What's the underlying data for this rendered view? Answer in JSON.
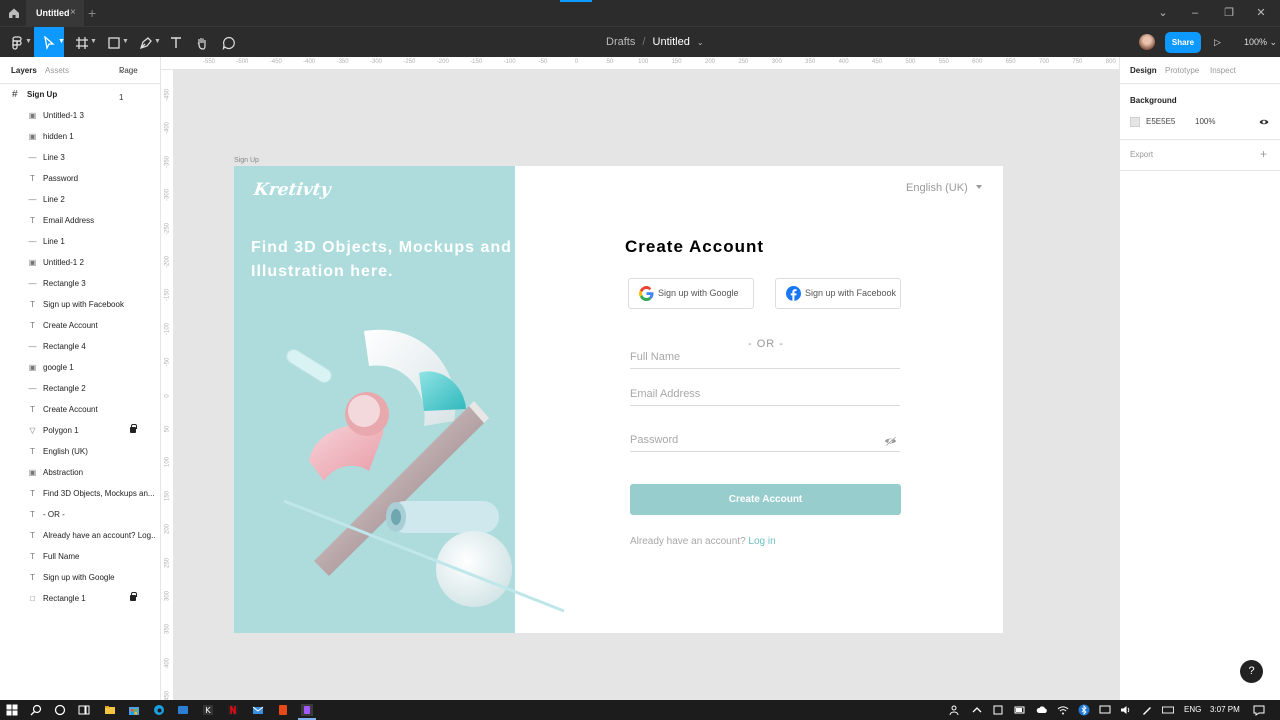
{
  "app": {
    "tab_title": "Untitled",
    "breadcrumb_folder": "Drafts",
    "breadcrumb_separator": "/",
    "breadcrumb_file": "Untitled",
    "share_label": "Share",
    "zoom_label": "100%"
  },
  "left_panel": {
    "tab_layers": "Layers",
    "tab_assets": "Assets",
    "page_selector": "Page 1",
    "frame_name": "Sign Up",
    "layers": [
      {
        "name": "Untitled-1 3",
        "icon": "image-icon",
        "locked": false
      },
      {
        "name": "hidden 1",
        "icon": "image-icon",
        "locked": false
      },
      {
        "name": "Line 3",
        "icon": "line-icon",
        "locked": false
      },
      {
        "name": "Password",
        "icon": "text-icon",
        "locked": false
      },
      {
        "name": "Line 2",
        "icon": "line-icon",
        "locked": false
      },
      {
        "name": "Email Address",
        "icon": "text-icon",
        "locked": false
      },
      {
        "name": "Line 1",
        "icon": "line-icon",
        "locked": false
      },
      {
        "name": "Untitled-1 2",
        "icon": "image-icon",
        "locked": false
      },
      {
        "name": "Rectangle 3",
        "icon": "line-icon",
        "locked": false
      },
      {
        "name": "Sign up with Facebook",
        "icon": "text-icon",
        "locked": false
      },
      {
        "name": "Create Account",
        "icon": "text-icon",
        "locked": false
      },
      {
        "name": "Rectangle 4",
        "icon": "line-icon",
        "locked": false
      },
      {
        "name": "google 1",
        "icon": "image-icon",
        "locked": false
      },
      {
        "name": "Rectangle 2",
        "icon": "line-icon",
        "locked": false
      },
      {
        "name": "Create Account",
        "icon": "text-icon",
        "locked": false
      },
      {
        "name": "Polygon 1",
        "icon": "polygon-icon",
        "locked": true
      },
      {
        "name": "English (UK)",
        "icon": "text-icon",
        "locked": false
      },
      {
        "name": "Abstraction",
        "icon": "image-icon",
        "locked": false
      },
      {
        "name": "Find 3D Objects, Mockups an...",
        "icon": "text-icon",
        "locked": false
      },
      {
        "name": "- OR -",
        "icon": "text-icon",
        "locked": false
      },
      {
        "name": "Already have an account? Log...",
        "icon": "text-icon",
        "locked": false
      },
      {
        "name": "Full Name",
        "icon": "text-icon",
        "locked": false
      },
      {
        "name": "Sign up with Google",
        "icon": "text-icon",
        "locked": false
      },
      {
        "name": "Rectangle 1",
        "icon": "rectangle-icon",
        "locked": true
      }
    ]
  },
  "rulers": {
    "top": [
      "-550",
      "-500",
      "-450",
      "-400",
      "-350",
      "-300",
      "-250",
      "-200",
      "-150",
      "-100",
      "-50",
      "0",
      "50",
      "100",
      "150",
      "200",
      "250",
      "300",
      "350",
      "400",
      "450",
      "500",
      "550",
      "600",
      "650",
      "700",
      "750",
      "800"
    ],
    "left": [
      "-450",
      "-400",
      "-350",
      "-300",
      "-250",
      "-200",
      "-150",
      "-100",
      "-50",
      "0",
      "50",
      "100",
      "150",
      "200",
      "250",
      "300",
      "350",
      "400",
      "450"
    ]
  },
  "right_panel": {
    "tab_design": "Design",
    "tab_prototype": "Prototype",
    "tab_inspect": "Inspect",
    "background_label": "Background",
    "background_hex": "E5E5E5",
    "background_opacity": "100%",
    "background_color": "#E5E5E5",
    "export_label": "Export"
  },
  "design": {
    "frame_label": "Sign Up",
    "logo_text": "Kretivty",
    "tagline": "Find 3D Objects, Mockups and Illustration here.",
    "language": "English (UK)",
    "title": "Create Account",
    "google_button": "Sign up with Google",
    "facebook_button": "Sign up with Facebook",
    "or_divider": "- OR -",
    "full_name_placeholder": "Full Name",
    "email_placeholder": "Email Address",
    "password_placeholder": "Password",
    "cta_label": "Create Account",
    "already_text": "Already have an account?",
    "login_link": "Log in",
    "accent_color": "#98CDCD",
    "hero_color": "#AEDCDC"
  },
  "taskbar": {
    "language": "ENG",
    "time": "3:07 PM"
  },
  "help_label": "?"
}
